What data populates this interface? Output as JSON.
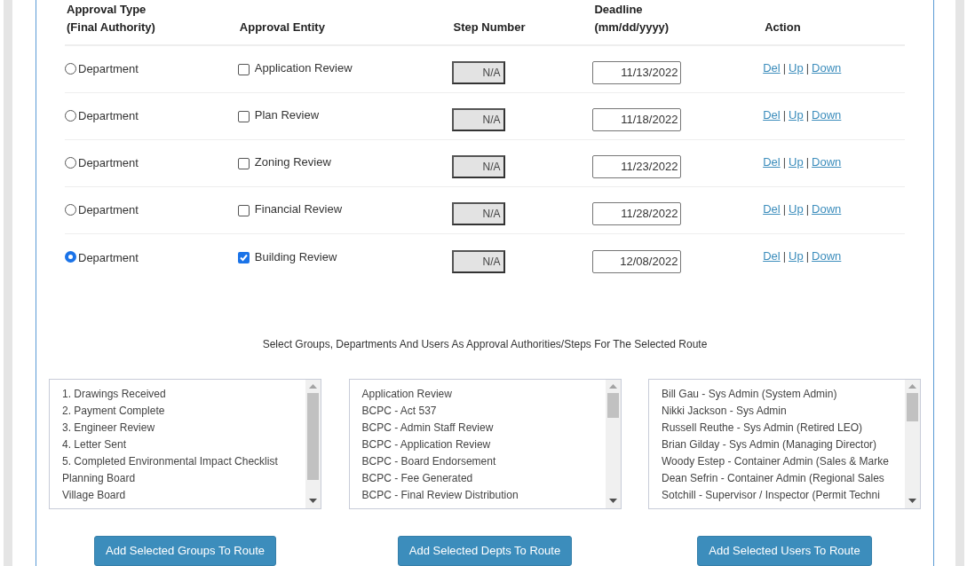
{
  "table": {
    "columns": [
      {
        "lines": [
          "Approval Type",
          "(Final Authority)"
        ]
      },
      {
        "lines": [
          "Approval Entity"
        ]
      },
      {
        "lines": [
          "Step Number"
        ]
      },
      {
        "lines": [
          "Deadline",
          "(mm/dd/yyyy)"
        ]
      },
      {
        "lines": [
          "Action"
        ]
      }
    ],
    "rows": [
      {
        "type_label": "Department",
        "type_selected": false,
        "entity": "Application Review",
        "entity_checked": false,
        "step": "N/A",
        "deadline": "11/13/2022",
        "actions": [
          {
            "kind": "link",
            "label": "Del"
          },
          {
            "kind": "separator",
            "label": "|"
          },
          {
            "kind": "link",
            "label": "Up"
          },
          {
            "kind": "separator",
            "label": "|"
          },
          {
            "kind": "link",
            "label": "Down"
          }
        ]
      },
      {
        "type_label": "Department",
        "type_selected": false,
        "entity": "Plan Review",
        "entity_checked": false,
        "step": "N/A",
        "deadline": "11/18/2022",
        "actions": [
          {
            "kind": "link",
            "label": "Del"
          },
          {
            "kind": "separator",
            "label": "|"
          },
          {
            "kind": "link",
            "label": "Up"
          },
          {
            "kind": "separator",
            "label": "|"
          },
          {
            "kind": "link",
            "label": "Down"
          }
        ]
      },
      {
        "type_label": "Department",
        "type_selected": false,
        "entity": "Zoning Review",
        "entity_checked": false,
        "step": "N/A",
        "deadline": "11/23/2022",
        "actions": [
          {
            "kind": "link",
            "label": "Del"
          },
          {
            "kind": "separator",
            "label": "|"
          },
          {
            "kind": "link",
            "label": "Up"
          },
          {
            "kind": "separator",
            "label": "|"
          },
          {
            "kind": "link",
            "label": "Down"
          }
        ]
      },
      {
        "type_label": "Department",
        "type_selected": false,
        "entity": "Financial Review",
        "entity_checked": false,
        "step": "N/A",
        "deadline": "11/28/2022",
        "actions": [
          {
            "kind": "link",
            "label": "Del"
          },
          {
            "kind": "separator",
            "label": "|"
          },
          {
            "kind": "link",
            "label": "Up"
          },
          {
            "kind": "separator",
            "label": "|"
          },
          {
            "kind": "link",
            "label": "Down"
          }
        ]
      },
      {
        "type_label": "Department",
        "type_selected": true,
        "entity": "Building Review",
        "entity_checked": true,
        "step": "N/A",
        "deadline": "12/08/2022",
        "actions": [
          {
            "kind": "link",
            "label": "Del"
          },
          {
            "kind": "separator",
            "label": "|"
          },
          {
            "kind": "link",
            "label": "Up"
          },
          {
            "kind": "separator",
            "label": "|"
          },
          {
            "kind": "link",
            "label": "Down"
          }
        ]
      }
    ]
  },
  "instructions": "Select Groups, Departments And Users As Approval Authorities/Steps For The Selected Route",
  "lists": [
    {
      "items": [
        "1. Drawings Received",
        "2. Payment Complete",
        "3. Engineer Review",
        "4. Letter Sent",
        "5. Completed Environmental Impact Checklist",
        "Planning Board",
        "Village Board"
      ],
      "button": "Add Selected Groups To Route"
    },
    {
      "items": [
        "Application Review",
        "BCPC - Act 537",
        "BCPC - Admin Staff Review",
        "BCPC - Application Review",
        "BCPC - Board Endorsement",
        "BCPC - Fee Generated",
        "BCPC - Final Review Distribution"
      ],
      "button": "Add Selected Depts To Route"
    },
    {
      "items": [
        "Bill Gau - Sys Admin (System Admin)",
        "Nikki Jackson - Sys Admin",
        "Russell Reuthe - Sys Admin (Retired LEO)",
        "Brian Gilday - Sys Admin (Managing Director)",
        "Woody Estep - Container Admin (Sales & Marke",
        "Dean Sefrin - Container Admin (Regional Sales",
        "Sotchill - Supervisor / Inspector (Permit Techni"
      ],
      "button": "Add Selected Users To Route"
    }
  ]
}
